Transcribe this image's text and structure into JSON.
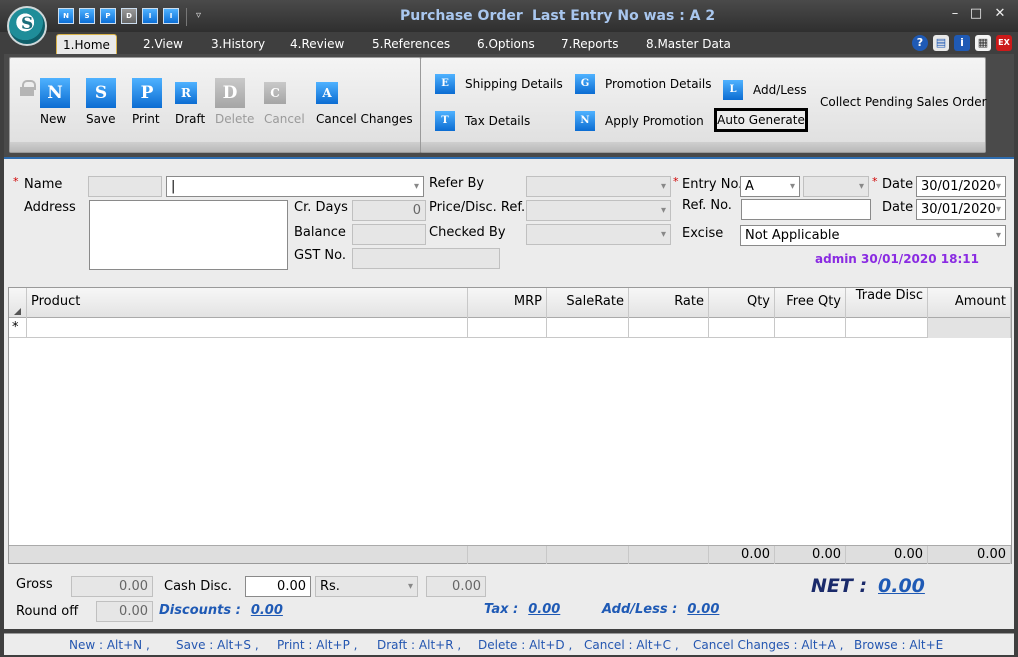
{
  "window": {
    "title": "Purchase Order",
    "last_entry": "Last Entry No was : A 2",
    "minimize": "–",
    "maximize": "□",
    "close": "✕"
  },
  "quick_access": [
    "N",
    "S",
    "P",
    "D",
    "I",
    "I"
  ],
  "tabs": [
    "1.Home",
    "2.View",
    "3.History",
    "4.Review",
    "5.References",
    "6.Options",
    "7.Reports",
    "8.Master Data"
  ],
  "ribbon": {
    "buttons": [
      {
        "label": "New",
        "glyph": "N"
      },
      {
        "label": "Save",
        "glyph": "S"
      },
      {
        "label": "Print",
        "glyph": "P"
      },
      {
        "label": "Draft",
        "glyph": "R"
      },
      {
        "label": "Delete",
        "glyph": "D"
      },
      {
        "label": "Cancel",
        "glyph": "C"
      },
      {
        "label": "Cancel Changes",
        "glyph": "A"
      }
    ],
    "options": [
      {
        "label": "Shipping Details",
        "glyph": "E"
      },
      {
        "label": "Tax Details",
        "glyph": "T"
      },
      {
        "label": "Promotion Details",
        "glyph": "G"
      },
      {
        "label": "Apply Promotion",
        "glyph": "N"
      },
      {
        "label": "Add/Less",
        "glyph": "L"
      }
    ],
    "auto_generate": "Auto Generate",
    "collect_pending": "Collect Pending Sales Order"
  },
  "form": {
    "name_label": "Name",
    "address_label": "Address",
    "cr_days_label": "Cr. Days",
    "cr_days_value": "0",
    "balance_label": "Balance",
    "gst_label": "GST No.",
    "refer_by_label": "Refer By",
    "price_disc_label": "Price/Disc. Ref.",
    "checked_by_label": "Checked By",
    "entry_no_label": "Entry No.",
    "entry_no_value": "A",
    "ref_no_label": "Ref. No.",
    "excise_label": "Excise",
    "excise_value": "Not Applicable",
    "date_label": "Date",
    "date_value": "30/01/2020",
    "date2_label": "Date",
    "date2_value": "30/01/2020",
    "admin_stamp": "admin 30/01/2020 18:11"
  },
  "grid": {
    "columns": [
      "Product",
      "MRP",
      "SaleRate",
      "Rate",
      "Qty",
      "Free Qty",
      "Trade Disc",
      "Amount"
    ],
    "new_row_marker": "*",
    "totals": {
      "qty": "0.00",
      "free_qty": "0.00",
      "trade_disc": "0.00",
      "amount": "0.00"
    }
  },
  "totals": {
    "gross_label": "Gross",
    "gross_value": "0.00",
    "round_off_label": "Round off",
    "round_off_value": "0.00",
    "cash_disc_label": "Cash Disc.",
    "cash_disc_value": "0.00",
    "cash_disc_unit": "Rs.",
    "cash_disc_amount": "0.00",
    "discounts_label": "Discounts :",
    "discounts_value": "0.00",
    "tax_label": "Tax :",
    "tax_value": "0.00",
    "addless_label": "Add/Less :",
    "addless_value": "0.00",
    "net_label": "NET :",
    "net_value": "0.00"
  },
  "shortcuts": [
    "New : Alt+N ,",
    "Save : Alt+S ,",
    "Print : Alt+P ,",
    "Draft : Alt+R ,",
    "Delete : Alt+D ,",
    "Cancel : Alt+C ,",
    "Cancel Changes : Alt+A ,",
    "Browse : Alt+E"
  ]
}
